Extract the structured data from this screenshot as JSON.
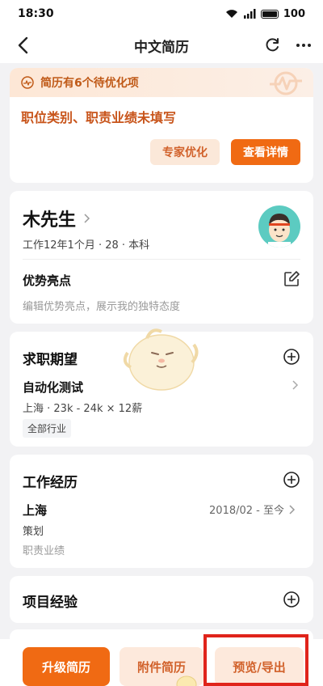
{
  "status": {
    "time": "18:30",
    "battery": "100",
    "signal": "5G"
  },
  "nav": {
    "title": "中文简历"
  },
  "optimize": {
    "header": "简历有6个待优化项",
    "message": "职位类别、职责业绩未填写",
    "expert_label": "专家优化",
    "detail_label": "查看详情"
  },
  "profile": {
    "name": "木先生",
    "meta": "工作12年1个月 · 28 · 本科",
    "advantage_title": "优势亮点",
    "advantage_placeholder": "编辑优势亮点，展示我的独特态度"
  },
  "expectation": {
    "title": "求职期望",
    "job": "自动化测试",
    "detail": "上海 · 23k - 24k × 12薪",
    "tag": "全部行业"
  },
  "work": {
    "title": "工作经历",
    "city": "上海",
    "date": "2018/02 - 至今",
    "role": "策划",
    "performance": "职责业绩"
  },
  "project": {
    "title": "项目经验"
  },
  "bottom": {
    "upgrade_label": "升级简历",
    "attach_label": "附件简历",
    "preview_label": "预览/导出"
  },
  "colors": {
    "accent": "#f06a13",
    "accent_light": "#fde9dc",
    "highlight": "#e0241b",
    "avatar_bg": "#5ccbc1"
  }
}
